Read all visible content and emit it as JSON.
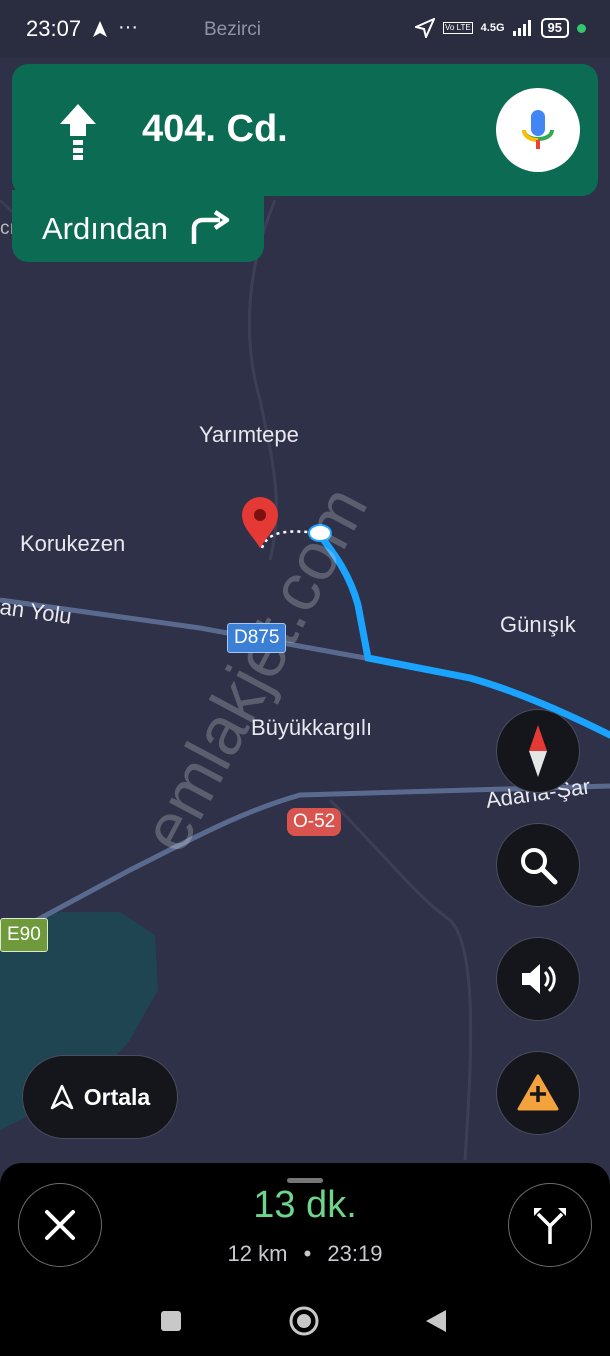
{
  "status_bar": {
    "time": "23:07",
    "carrier_label": "Bezirci",
    "network": "4.5G",
    "volte": "Vo LTE",
    "battery": "95"
  },
  "navigation": {
    "street": "404. Cd.",
    "then_label": "Ardından"
  },
  "map": {
    "places": [
      "Yarımtepe",
      "Korukezen",
      "Günışık",
      "Büyükkargılı"
    ],
    "road_names": [
      "an Yolu",
      "Adana-Şar"
    ],
    "edge_label": "cıl",
    "shields": {
      "d875": "D875",
      "o52": "O-52",
      "e90": "E90"
    },
    "watermark": "emlakjet.com",
    "colors": {
      "route": "#1aa3ff",
      "nav_header": "#0b6b53",
      "pin": "#e53935",
      "eta": "#6dd58c"
    }
  },
  "controls": {
    "recenter_label": "Ortala"
  },
  "trip": {
    "eta_duration": "13 dk.",
    "distance": "12 km",
    "separator": "•",
    "arrival_time": "23:19"
  }
}
